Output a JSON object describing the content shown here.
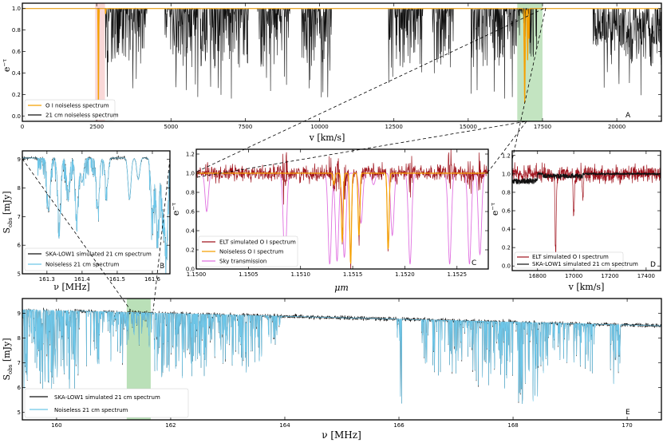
{
  "colors": {
    "orange": "#f5a000",
    "black": "#111111",
    "darkred": "#a0141e",
    "cyan": "#6ec6e8",
    "magenta": "#e070e0",
    "green_band": "#a9d8a6",
    "pink_band": "#f7c8c8"
  },
  "chart_data": [
    {
      "panel": "A",
      "type": "line",
      "xlabel": "v [km/s]",
      "ylabel": "e^-τ",
      "xlim": [
        0,
        21500
      ],
      "ylim": [
        -0.05,
        1.05
      ],
      "xticks": [
        0,
        2500,
        5000,
        7500,
        10000,
        12500,
        15000,
        17500,
        20000
      ],
      "yticks": [
        0.0,
        0.2,
        0.4,
        0.6,
        0.8,
        1.0
      ],
      "highlight_bands": [
        {
          "x0": 2450,
          "x1": 2780,
          "color": "pink"
        },
        {
          "x0": 16650,
          "x1": 17500,
          "color": "green"
        }
      ],
      "series": [
        {
          "name": "O I noiseless spectrum",
          "color": "orange",
          "absorption_lines": [
            [
              2560,
              0.0,
              15
            ],
            [
              2800,
              0.95,
              12
            ],
            [
              16900,
              0.12,
              25
            ],
            [
              17000,
              0.52,
              20
            ],
            [
              17050,
              0.72,
              12
            ]
          ]
        },
        {
          "name": "21 cm noiseless spectrum",
          "color": "black",
          "absorption_regions": [
            [
              2800,
              4200
            ],
            [
              4800,
              7600
            ],
            [
              7900,
              9000
            ],
            [
              9400,
              10400
            ],
            [
              12300,
              13500
            ],
            [
              13800,
              14500
            ],
            [
              15100,
              17300
            ],
            [
              19300,
              21500
            ]
          ]
        }
      ],
      "legend_loc": "lower left"
    },
    {
      "panel": "B",
      "type": "line",
      "xlabel": "ν [MHz]",
      "ylabel": "S_obs [mJy]",
      "xlim": [
        161.23,
        161.65
      ],
      "ylim": [
        5,
        9.3
      ],
      "xticks": [
        161.3,
        161.4,
        161.5,
        161.6
      ],
      "yticks": [
        5,
        6,
        7,
        8,
        9
      ],
      "series": [
        {
          "name": "SKA-LOW1 simulated 21 cm spectrum",
          "color": "black"
        },
        {
          "name": "Noiseless 21 cm spectrum",
          "color": "cyan"
        }
      ],
      "legend_loc": "lower left"
    },
    {
      "panel": "C",
      "type": "line",
      "xlabel": "μm",
      "ylabel": "e^-τ",
      "xlim": [
        1.15,
        1.1528
      ],
      "ylim": [
        0,
        1.25
      ],
      "xticks": [
        1.15,
        1.1505,
        1.151,
        1.1515,
        1.152,
        1.1525
      ],
      "yticks": [
        0.0,
        0.2,
        0.4,
        0.6,
        0.8,
        1.0,
        1.2
      ],
      "series": [
        {
          "name": "ELT simulated O I spectrum",
          "color": "darkred"
        },
        {
          "name": "Noiseless O I spectrum",
          "color": "orange",
          "absorption_lines": [
            [
              1.15132,
              0.88
            ],
            [
              1.1514,
              0.28
            ],
            [
              1.15148,
              0.05
            ],
            [
              1.15156,
              0.35
            ],
            [
              1.15184,
              0.2
            ]
          ]
        },
        {
          "name": "Sky transmission",
          "color": "magenta",
          "absorption_lines": [
            [
              1.1501,
              0.6
            ],
            [
              1.15085,
              0.05
            ],
            [
              1.15128,
              0.05
            ],
            [
              1.15135,
              0.08
            ],
            [
              1.15142,
              0.12
            ],
            [
              1.15158,
              0.48
            ],
            [
              1.1517,
              0.88
            ],
            [
              1.15188,
              0.35
            ],
            [
              1.15205,
              0.05
            ],
            [
              1.15243,
              0.05
            ],
            [
              1.15262,
              0.05
            ],
            [
              1.15272,
              0.15
            ]
          ]
        }
      ],
      "legend_loc": "lower left"
    },
    {
      "panel": "D",
      "type": "line",
      "xlabel": "v [km/s]",
      "ylabel": "e^-τ",
      "xlim": [
        16660,
        17480
      ],
      "ylim": [
        -0.05,
        1.25
      ],
      "xticks": [
        16800,
        17000,
        17200,
        17400
      ],
      "yticks": [
        0.0,
        0.2,
        0.4,
        0.6,
        0.8,
        1.0,
        1.2
      ],
      "series": [
        {
          "name": "ELT simulated O I spectrum",
          "color": "darkred"
        },
        {
          "name": "SKA-LOW1 simulated 21 cm spectrum",
          "color": "black"
        }
      ],
      "legend_loc": "lower left"
    },
    {
      "panel": "E",
      "type": "line",
      "xlabel": "ν [MHz]",
      "ylabel": "S_obs [mJy]",
      "xlim": [
        159.4,
        170.6
      ],
      "ylim": [
        4.7,
        9.6
      ],
      "xticks": [
        160,
        162,
        164,
        166,
        168,
        170
      ],
      "yticks": [
        5,
        6,
        7,
        8,
        9
      ],
      "highlight_bands": [
        {
          "x0": 161.23,
          "x1": 161.65,
          "color": "green"
        }
      ],
      "continuum": [
        [
          159.4,
          9.15
        ],
        [
          170.6,
          8.5
        ]
      ],
      "series": [
        {
          "name": "SKA-LOW1 simulated 21 cm spectrum",
          "color": "black"
        },
        {
          "name": "Noiseless 21 cm spectrum",
          "color": "cyan"
        }
      ],
      "legend_loc": "lower left"
    }
  ],
  "labels": {
    "A": {
      "xlabel": "v [km/s]",
      "ylabel": "e",
      "ysup": "−τ",
      "letter": "A",
      "leg1": "O I noiseless spectrum",
      "leg2": "21 cm noiseless spectrum"
    },
    "B": {
      "xlabel": "ν [MHz]",
      "ylabel": "S",
      "ysub": "obs",
      "yunit": " [mJy]",
      "letter": "B",
      "leg1": "SKA-LOW1 simulated 21 cm spectrum",
      "leg2": "Noiseless 21 cm spectrum"
    },
    "C": {
      "xlabel": "μm",
      "ylabel": "e",
      "ysup": "−τ",
      "letter": "C",
      "leg1": "ELT simulated O I spectrum",
      "leg2": "Noiseless O I spectrum",
      "leg3": "Sky transmission"
    },
    "D": {
      "xlabel": "v [km/s]",
      "ylabel": "e",
      "ysup": "−τ",
      "letter": "D",
      "leg1": "ELT simulated O I spectrum",
      "leg2": "SKA-LOW1 simulated 21 cm spectrum"
    },
    "E": {
      "xlabel": "ν [MHz]",
      "ylabel": "S",
      "ysub": "obs",
      "yunit": " [mJy]",
      "letter": "E",
      "leg1": "SKA-LOW1 simulated 21 cm spectrum",
      "leg2": "Noiseless 21 cm spectrum"
    }
  }
}
